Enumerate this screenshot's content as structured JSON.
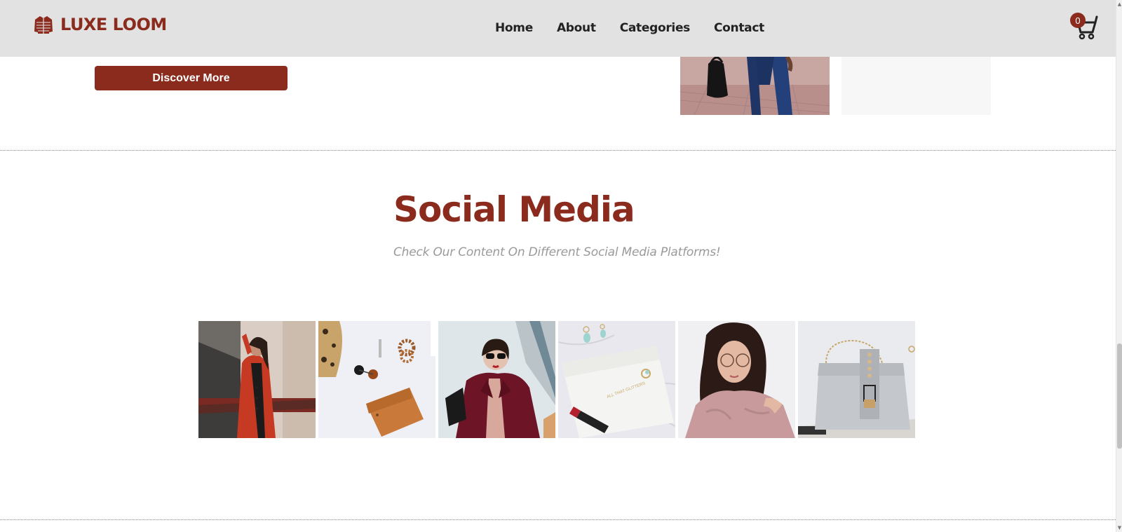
{
  "brand": {
    "name": "LUXE LOOM",
    "icon": "jacket-icon",
    "color": "#8a2b1d"
  },
  "nav": {
    "items": [
      {
        "label": "Home"
      },
      {
        "label": "About"
      },
      {
        "label": "Categories"
      },
      {
        "label": "Contact"
      }
    ]
  },
  "cart": {
    "count": "0",
    "icon": "cart-icon"
  },
  "hero": {
    "button_label": "Discover More"
  },
  "social": {
    "title": "Social Media",
    "subtitle": "Check Our Content On Different Social Media Platforms!",
    "images": [
      {
        "subject": "woman-red-coat-photo"
      },
      {
        "subject": "accessories-flatlay-photo"
      },
      {
        "subject": "woman-sunglasses-photo"
      },
      {
        "subject": "clutch-lipstick-photo"
      },
      {
        "subject": "woman-pink-top-photo"
      },
      {
        "subject": "grey-handbag-photo"
      }
    ]
  },
  "colors": {
    "accent": "#8a2b1d",
    "header_bg": "#e2e2e2",
    "subtitle": "#9a9a9a"
  }
}
